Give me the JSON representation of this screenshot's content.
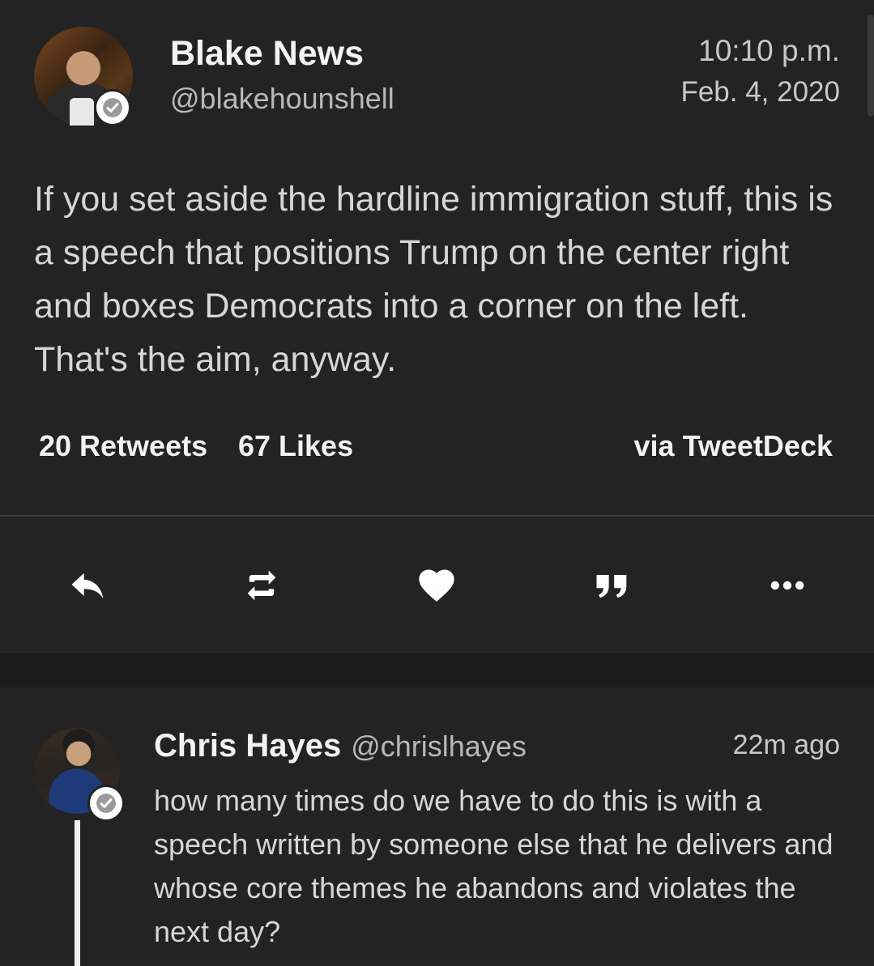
{
  "tweet": {
    "author_name": "Blake News",
    "author_handle": "@blakehounshell",
    "time": "10:10 p.m.",
    "date": "Feb. 4, 2020",
    "text": "If you set aside the hardline immigration stuff, this is a speech that positions Trump on the center right and boxes Democrats into a corner on the left. That's the aim, anyway.",
    "retweets": "20 Retweets",
    "likes": "67 Likes",
    "via": "via TweetDeck",
    "verified_icon": "verified-badge-icon"
  },
  "actions": [
    {
      "icon": "reply-icon"
    },
    {
      "icon": "retweet-icon"
    },
    {
      "icon": "like-heart-icon"
    },
    {
      "icon": "quote-icon"
    },
    {
      "icon": "more-options-icon"
    }
  ],
  "reply": {
    "author_name": "Chris Hayes",
    "author_handle": "@chrislhayes",
    "time": "22m ago",
    "text": "how many times do we have to do this is with a speech written by someone else that he delivers and whose core themes he abandons and violates the next day?"
  },
  "colors": {
    "background": "#1b1b1b",
    "card": "#232323",
    "primary_text": "#f2f2f2",
    "secondary_text": "#b8b8b8"
  }
}
